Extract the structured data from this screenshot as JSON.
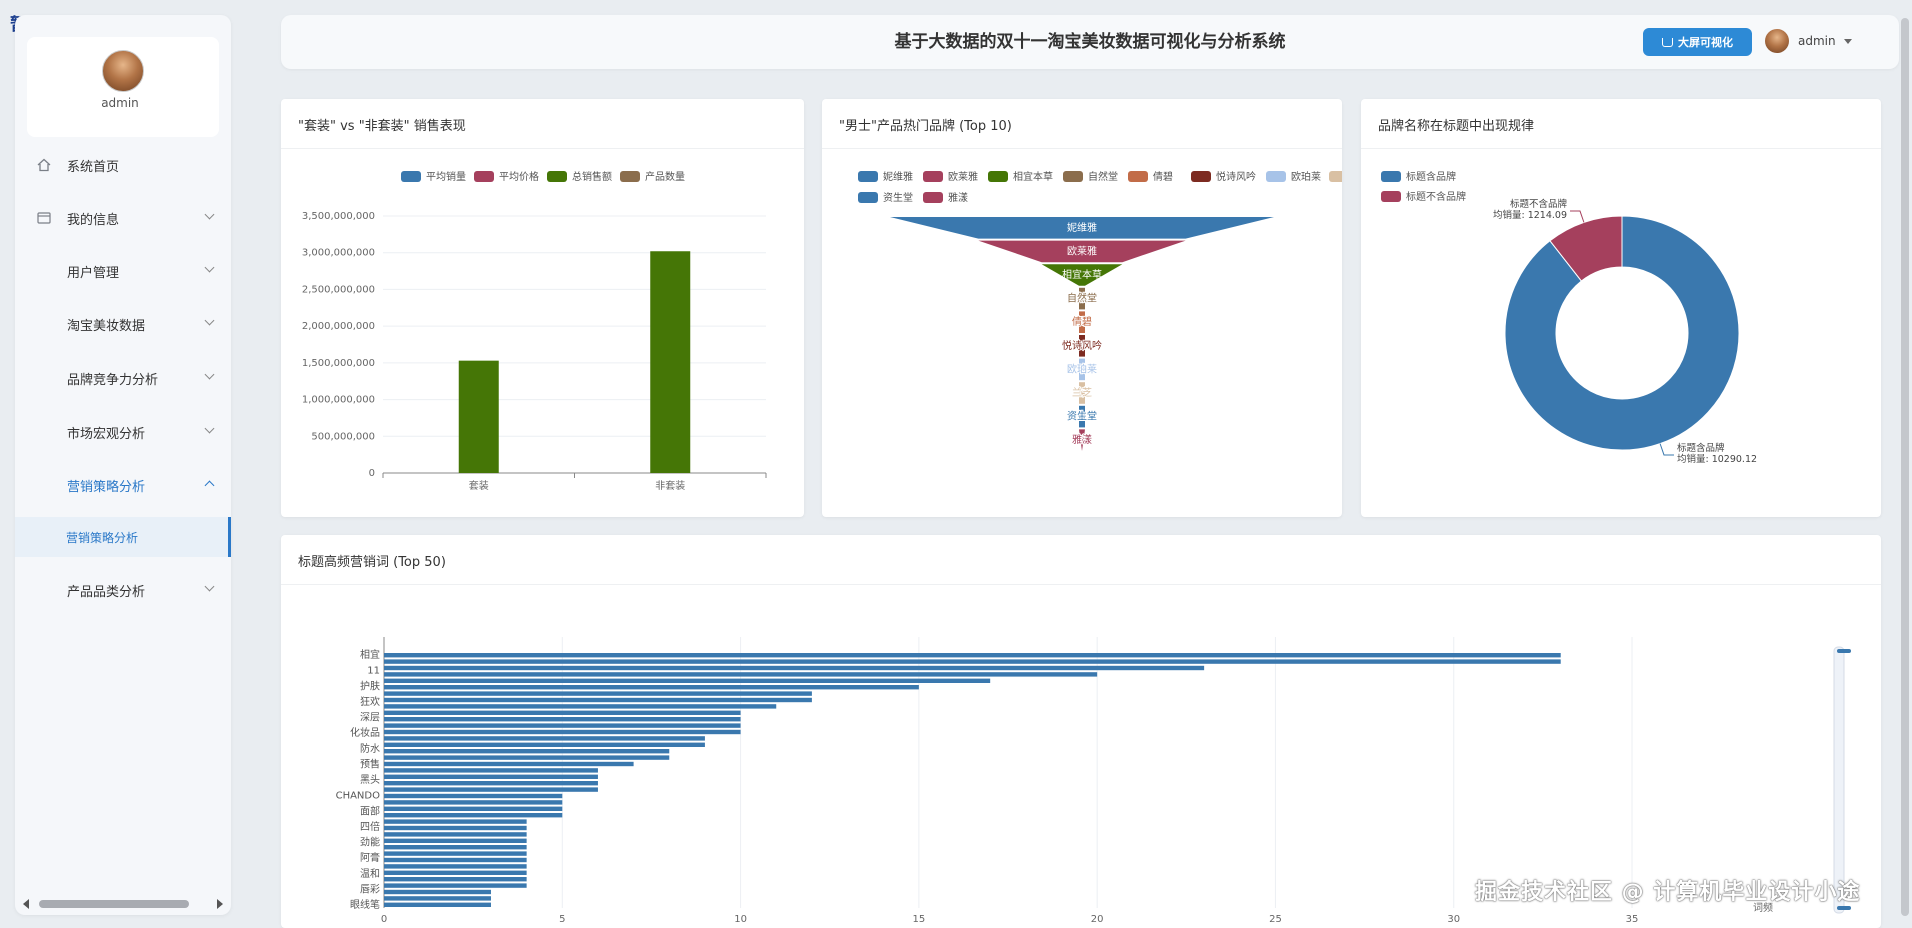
{
  "overlay_label": "暂停",
  "sidebar": {
    "user_name": "admin",
    "menu": [
      {
        "label": "系统首页",
        "icon": "home-icon",
        "has_chevron": false,
        "active": false
      },
      {
        "label": "我的信息",
        "icon": "id-card-icon",
        "has_chevron": true,
        "active": false
      },
      {
        "label": "用户管理",
        "icon": "grid-icon",
        "has_chevron": true,
        "active": false
      },
      {
        "label": "淘宝美妆数据",
        "icon": "grid-icon",
        "has_chevron": true,
        "active": false
      },
      {
        "label": "品牌竞争力分析",
        "icon": "grid-icon",
        "has_chevron": true,
        "active": false
      },
      {
        "label": "市场宏观分析",
        "icon": "grid-icon",
        "has_chevron": true,
        "active": false
      },
      {
        "label": "营销策略分析",
        "icon": "grid-icon",
        "has_chevron": true,
        "active": true
      },
      {
        "label": "产品品类分析",
        "icon": "grid-icon",
        "has_chevron": true,
        "active": false
      }
    ],
    "submenu_label": "营销策略分析"
  },
  "header": {
    "title": "基于大数据的双十一淘宝美妆数据可视化与分析系统",
    "bigscreen_label": "大屏可视化",
    "user_name": "admin"
  },
  "colors": {
    "accent": "#2d8ad6",
    "series": [
      "#3a78ae",
      "#a5405d",
      "#457606",
      "#8b6d4c",
      "#c26c48",
      "#7d2b21",
      "#a7c3e8",
      "#d9c0a3"
    ]
  },
  "chart_data": [
    {
      "type": "bar",
      "title": "\"套装\" vs \"非套装\" 销售表现",
      "legend": [
        "平均销量",
        "平均价格",
        "总销售额",
        "产品数量"
      ],
      "legend_position": "top-center",
      "categories": [
        "套装",
        "非套装"
      ],
      "series": [
        {
          "name": "平均销量",
          "values": [
            0,
            0
          ]
        },
        {
          "name": "平均价格",
          "values": [
            0,
            0
          ]
        },
        {
          "name": "总销售额",
          "values": [
            1530000000,
            3020000000
          ]
        },
        {
          "name": "产品数量",
          "values": [
            0,
            0
          ]
        }
      ],
      "yticks": [
        "0",
        "500,000,000",
        "1,000,000,000",
        "1,500,000,000",
        "2,000,000,000",
        "2,500,000,000",
        "3,000,000,000",
        "3,500,000,000"
      ],
      "ylim": [
        0,
        3500000000
      ],
      "grid": true
    },
    {
      "type": "funnel",
      "title": "\"男士\"产品热门品牌 (Top 10)",
      "legend": [
        "妮维雅",
        "欧莱雅",
        "相宜本草",
        "自然堂",
        "倩碧",
        "悦诗风吟",
        "欧珀莱",
        "兰芝",
        "资生堂",
        "雅漾"
      ],
      "legend_position": "top-center",
      "categories": [
        "妮维雅",
        "欧莱雅",
        "相宜本草",
        "自然堂",
        "倩碧",
        "悦诗风吟",
        "欧珀莱",
        "兰芝",
        "资生堂",
        "雅漾"
      ],
      "values": [
        100,
        54,
        21,
        1,
        1,
        1,
        1,
        1,
        1,
        1
      ]
    },
    {
      "type": "pie",
      "title": "品牌名称在标题中出现规律",
      "legend": [
        "标题含品牌",
        "标题不含品牌"
      ],
      "legend_position": "top-left",
      "labels": [
        "标题含品牌\n均销量: 10290.12",
        "标题不含品牌\n均销量: 1214.09"
      ],
      "slices": [
        {
          "name": "标题含品牌",
          "value": 10290.12
        },
        {
          "name": "标题不含品牌",
          "value": 1214.09
        }
      ]
    },
    {
      "type": "bar",
      "orientation": "horizontal",
      "title": "标题高频营销词 (Top 50)",
      "xlabel": "词频",
      "visible_ylabels": [
        "相宜",
        "11",
        "护肤",
        "狂欢",
        "深层",
        "化妆品",
        "防水",
        "预售",
        "黑头",
        "CHANDO",
        "面部",
        "四倍",
        "劲能",
        "阿膏",
        "温和",
        "唇彩",
        "眼线笔"
      ],
      "values": [
        33,
        33,
        23,
        20,
        17,
        15,
        12,
        12,
        11,
        10,
        10,
        10,
        10,
        9,
        9,
        8,
        8,
        7,
        6,
        6,
        6,
        6,
        5,
        5,
        5,
        5,
        4,
        4,
        4,
        4,
        4,
        4,
        4,
        4,
        4,
        4,
        4,
        3,
        3,
        3
      ],
      "xticks": [
        "0",
        "5",
        "10",
        "15",
        "20",
        "25",
        "30",
        "35"
      ],
      "xlim": [
        0,
        38
      ],
      "grid": true
    }
  ],
  "watermark": "掘金技术社区 @ 计算机毕业设计小途"
}
